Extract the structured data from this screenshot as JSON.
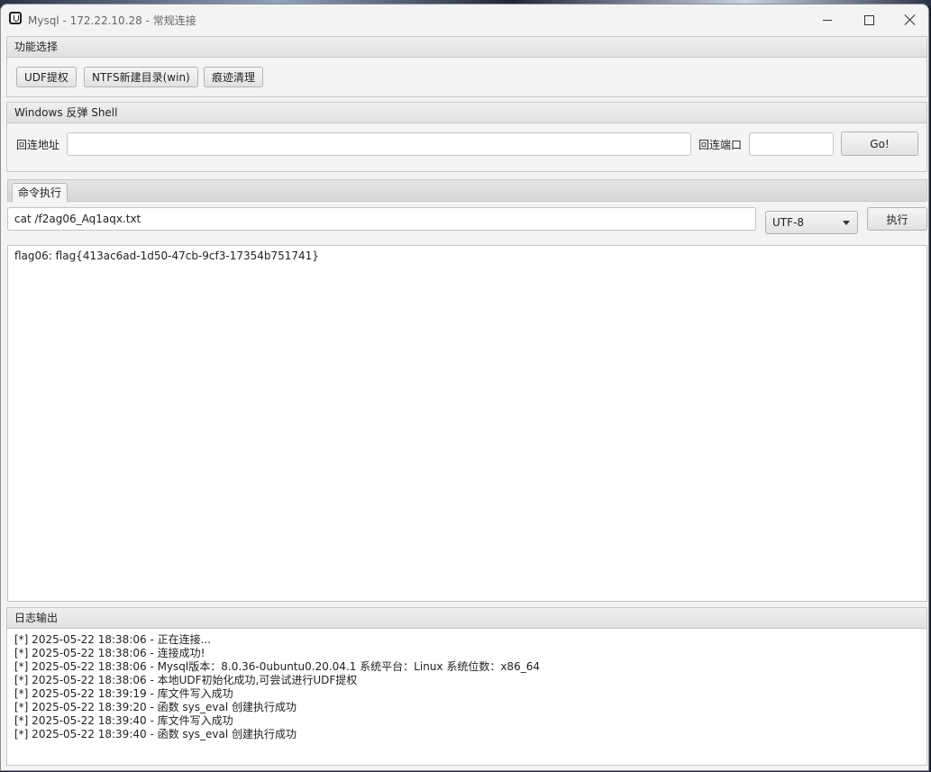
{
  "window": {
    "title": "Mysql - 172.22.10.28 - 常规连接"
  },
  "function_panel": {
    "header": "功能选择",
    "buttons": [
      "UDF提权",
      "NTFS新建目录(win)",
      "痕迹清理"
    ]
  },
  "reverse_shell_panel": {
    "header": "Windows 反弹 Shell",
    "address_label": "回连地址",
    "address_value": "",
    "port_label": "回连端口",
    "port_value": "",
    "go_label": "Go!"
  },
  "command_tab": {
    "label": "命令执行",
    "command_value": "cat /f2ag06_Aq1aqx.txt",
    "encoding": "UTF-8",
    "execute_label": "执行"
  },
  "output": {
    "lines": [
      "flag06: flag{413ac6ad-1d50-47cb-9cf3-17354b751741}"
    ]
  },
  "log_panel": {
    "header": "日志输出",
    "lines": [
      "[*] 2025-05-22 18:38:06 - 正在连接...",
      "[*] 2025-05-22 18:38:06 - 连接成功!",
      "[*] 2025-05-22 18:38:06 - Mysql版本：8.0.36-0ubuntu0.20.04.1 系统平台：Linux 系统位数：x86_64",
      "[*] 2025-05-22 18:38:06 - 本地UDF初始化成功,可尝试进行UDF提权",
      "[*] 2025-05-22 18:39:19 - 库文件写入成功",
      "[*] 2025-05-22 18:39:20 - 函数 sys_eval 创建执行成功",
      "[*] 2025-05-22 18:39:40 - 库文件写入成功",
      "[*] 2025-05-22 18:39:40 - 函数 sys_eval 创建执行成功"
    ]
  },
  "icons": {
    "app": "app-icon",
    "minimize": "minimize-icon",
    "maximize": "maximize-icon",
    "close": "close-icon",
    "dropdown": "chevron-down-icon"
  }
}
